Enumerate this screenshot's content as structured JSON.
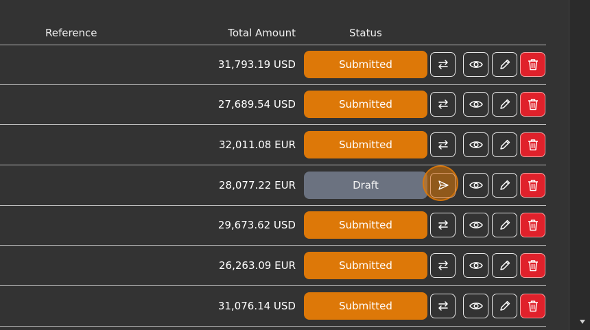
{
  "header": {
    "reference": "Reference",
    "total_amount": "Total Amount",
    "status": "Status"
  },
  "rows": [
    {
      "amount": "31,793.19 USD",
      "status": "Submitted",
      "action_icon": "swap-icon"
    },
    {
      "amount": "27,689.54 USD",
      "status": "Submitted",
      "action_icon": "swap-icon"
    },
    {
      "amount": "32,011.08 EUR",
      "status": "Submitted",
      "action_icon": "swap-icon"
    },
    {
      "amount": "28,077.22 EUR",
      "status": "Draft",
      "action_icon": "send-icon"
    },
    {
      "amount": "29,673.62 USD",
      "status": "Submitted",
      "action_icon": "swap-icon"
    },
    {
      "amount": "26,263.09 EUR",
      "status": "Submitted",
      "action_icon": "swap-icon"
    },
    {
      "amount": "31,076.14 USD",
      "status": "Submitted",
      "action_icon": "swap-icon"
    }
  ],
  "icons": {
    "view": "eye-icon",
    "edit": "pencil-icon",
    "delete": "trash-icon"
  },
  "colors": {
    "submitted": "#dd7808",
    "draft": "#6b7280",
    "delete": "#e0212b",
    "background": "#333333"
  }
}
